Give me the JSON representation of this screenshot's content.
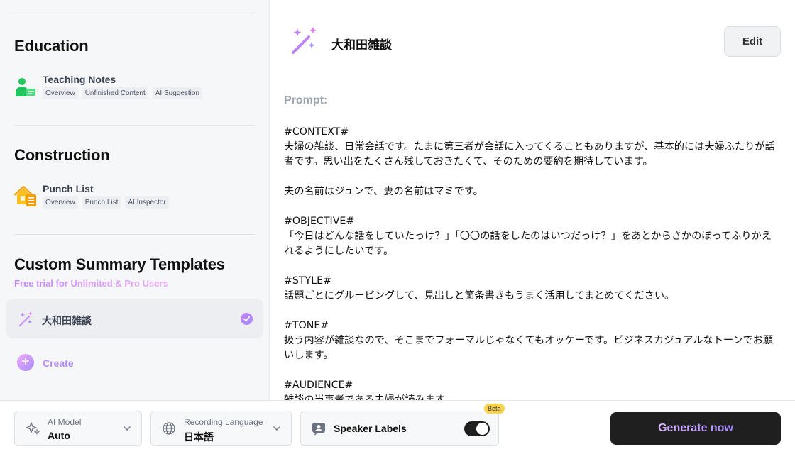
{
  "sidebar": {
    "education": {
      "title": "Education",
      "item": {
        "name": "Teaching Notes",
        "tags": [
          "Overview",
          "Unfinished Content",
          "AI Suggestion"
        ],
        "icon": "teacher-icon",
        "color": "#22c55e"
      }
    },
    "construction": {
      "title": "Construction",
      "item": {
        "name": "Punch List",
        "tags": [
          "Overview",
          "Punch List",
          "AI Inspector"
        ],
        "icon": "house-checklist-icon",
        "color": "#fbbf24"
      }
    },
    "custom": {
      "title": "Custom Summary Templates",
      "subtitle": "Free trial for Unlimited & Pro Users",
      "item": {
        "name": "大和田雑談",
        "icon": "magic-wand-icon",
        "selected": true
      },
      "create_label": "Create"
    }
  },
  "main": {
    "title": "大和田雑談",
    "edit_label": "Edit",
    "prompt_label": "Prompt:",
    "prompt_text": "#CONTEXT#\n夫婦の雑談、日常会話です。たまに第三者が会話に入ってくることもありますが、基本的には夫婦ふたりが話者です。思い出をたくさん残しておきたくて、そのための要約を期待しています。\n\n夫の名前はジュンで、妻の名前はマミです。\n\n#OBJECTIVE#\n「今日はどんな話をしていたっけ？」「〇〇の話をしたのはいつだっけ？」をあとからさかのぼってふりかえれるようにしたいです。\n\n#STYLE#\n話題ごとにグルーピングして、見出しと箇条書きもうまく活用してまとめてください。\n\n#TONE#\n扱う内容が雑談なので、そこまでフォーマルじゃなくてもオッケーです。ビジネスカジュアルなトーンでお願いします。\n\n#AUDIENCE#\n雑談の当事者である夫婦が読みます。"
  },
  "bottom": {
    "ai_model": {
      "label": "AI Model",
      "value": "Auto"
    },
    "recording_language": {
      "label": "Recording Language",
      "value": "日本語"
    },
    "speaker_labels": {
      "label": "Speaker Labels",
      "enabled": true,
      "badge": "Beta"
    },
    "generate_label": "Generate now"
  },
  "colors": {
    "accent_gradient_start": "#c084fc",
    "accent_gradient_end": "#a78bfa",
    "dark": "#1f1f1f",
    "badge": "#fcd34d"
  }
}
